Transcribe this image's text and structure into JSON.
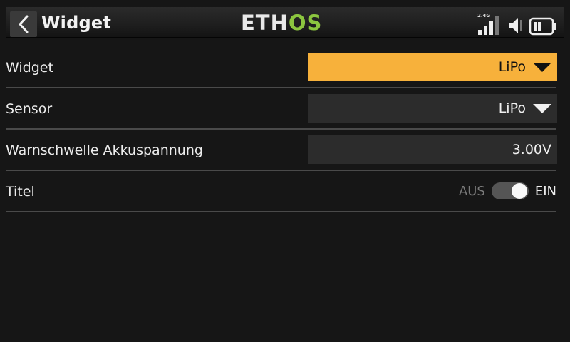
{
  "header": {
    "title": "Widget",
    "logo_part1": "ETH",
    "logo_part2": "OS",
    "band_label": "2.4G",
    "icons": {
      "back": "chevron-left-icon",
      "signal": "signal-bars-icon",
      "volume": "speaker-icon",
      "battery": "battery-icon"
    }
  },
  "colors": {
    "selected_field": "#f7b13b",
    "logo_green": "#8cc63f",
    "background": "#161616",
    "field_background": "#2c2c2c"
  },
  "rows": [
    {
      "label": "Widget",
      "value": "LiPo",
      "type": "dropdown",
      "selected": true
    },
    {
      "label": "Sensor",
      "value": "LiPo",
      "type": "dropdown",
      "selected": false
    },
    {
      "label": "Warnschwelle Akkuspannung",
      "value": "3.00V",
      "type": "number"
    },
    {
      "label": "Titel",
      "type": "toggle",
      "off_label": "AUS",
      "on_label": "EIN",
      "state": "on"
    }
  ]
}
